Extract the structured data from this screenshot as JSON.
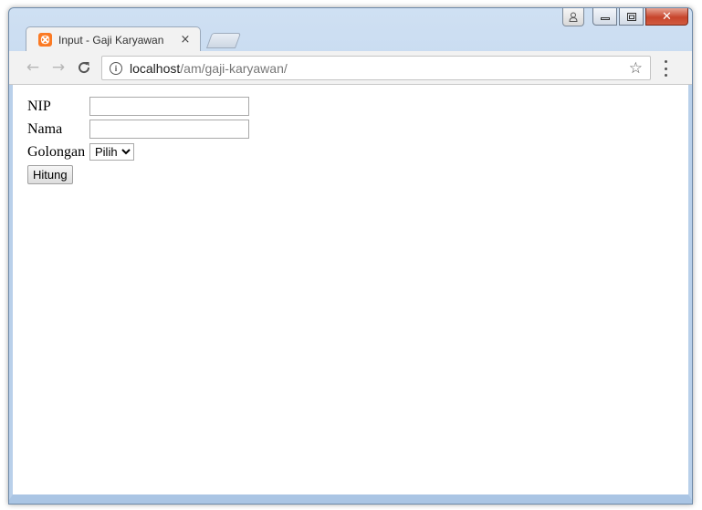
{
  "browser": {
    "tab": {
      "title": "Input - Gaji Karyawan",
      "close_glyph": "×",
      "favicon": "xampp-icon"
    },
    "window_controls": {
      "minimize": "minimize-icon",
      "maximize": "maximize-icon",
      "close": "close-icon",
      "close_glyph": "✕"
    },
    "address_bar": {
      "host": "localhost",
      "path": "/am/gaji-karyawan/"
    }
  },
  "form": {
    "nip_label": "NIP",
    "nip_value": "",
    "nama_label": "Nama",
    "nama_value": "",
    "golongan_label": "Golongan",
    "golongan_selected": "Pilih",
    "submit_label": "Hitung"
  },
  "colors": {
    "favicon": "#fb7a24",
    "close_button": "#c7452c"
  }
}
